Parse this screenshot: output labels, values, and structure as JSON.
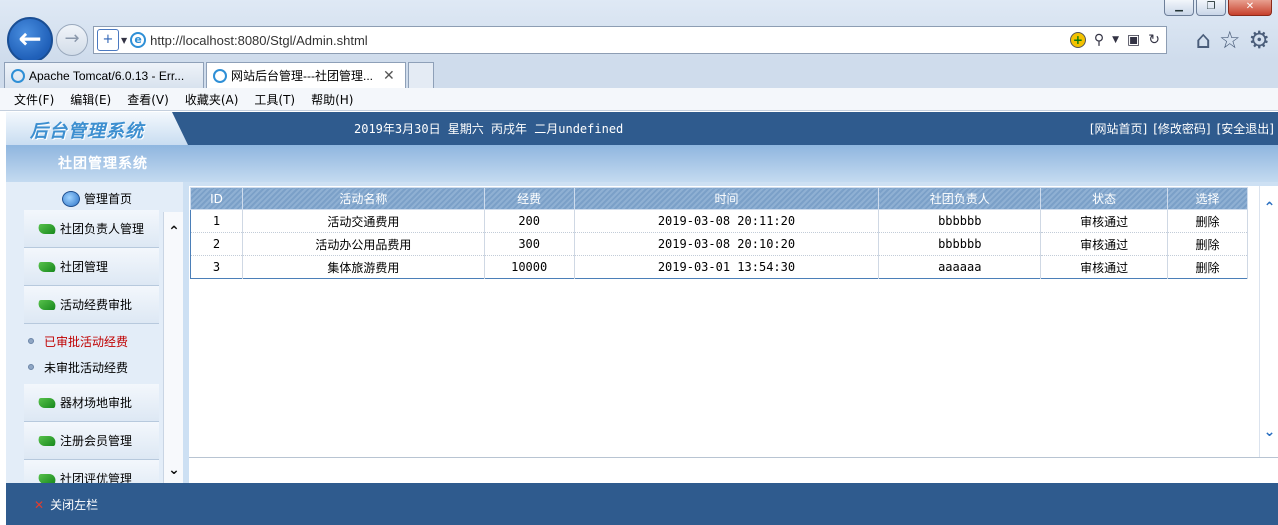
{
  "browser": {
    "url": "http://localhost:8080/Stgl/Admin.shtml",
    "tabs": [
      {
        "label": "Apache Tomcat/6.0.13 - Err..."
      },
      {
        "label": "网站后台管理---社团管理...",
        "close": "✕"
      }
    ],
    "menu": [
      "文件(F)",
      "编辑(E)",
      "查看(V)",
      "收藏夹(A)",
      "工具(T)",
      "帮助(H)"
    ],
    "window_controls": [
      "▁",
      "❐",
      "✕"
    ]
  },
  "app": {
    "logo": "后台管理系统",
    "date": "2019年3月30日 星期六 丙戌年 二月undefined",
    "header_links": [
      "[网站首页]",
      "[修改密码]",
      "[安全退出]"
    ],
    "system_title": "社团管理系统"
  },
  "sidebar": {
    "home": "管理首页",
    "items": [
      {
        "label": "社团负责人管理",
        "icon": "leaf-icon"
      },
      {
        "label": "社团管理",
        "icon": "leaf-icon"
      },
      {
        "label": "活动经费审批",
        "icon": "leaf-icon"
      }
    ],
    "sub_items": [
      {
        "label": "已审批活动经费",
        "active": true
      },
      {
        "label": "未审批活动经费",
        "active": false
      }
    ],
    "items_after": [
      {
        "label": "器材场地审批",
        "icon": "leaf-icon"
      },
      {
        "label": "注册会员管理",
        "icon": "leaf-icon"
      },
      {
        "label": "社团评优管理",
        "icon": "leaf-icon"
      }
    ]
  },
  "table": {
    "headers": [
      "ID",
      "活动名称",
      "经费",
      "时间",
      "社团负责人",
      "状态",
      "选择"
    ],
    "rows": [
      [
        "1",
        "活动交通费用",
        "200",
        "2019-03-08 20:11:20",
        "bbbbbb",
        "审核通过",
        "删除"
      ],
      [
        "2",
        "活动办公用品费用",
        "300",
        "2019-03-08 20:10:20",
        "bbbbbb",
        "审核通过",
        "删除"
      ],
      [
        "3",
        "集体旅游费用",
        "10000",
        "2019-03-01 13:54:30",
        "aaaaaa",
        "审核通过",
        "删除"
      ]
    ]
  },
  "footer": {
    "close_sidebar": "关闭左栏"
  },
  "colors": {
    "header_bg": "#2f5b8e",
    "active_sub_item": "#c00000",
    "table_header": "#7ba0c8"
  }
}
